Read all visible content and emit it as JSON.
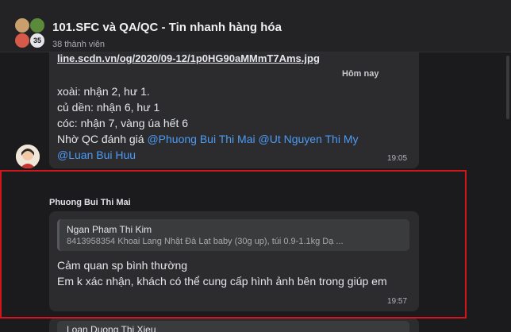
{
  "header": {
    "title": "101.SFC và QA/QC - Tin nhanh hàng hóa",
    "members": "38 thành viên",
    "member_count_badge": "35"
  },
  "message1": {
    "link_text": "line.scdn.vn/og/2020/09-12/1p0HG90aMMmT7Ams.jpg",
    "date_chip": "Hôm nay",
    "lines": [
      "xoài: nhận 2, hư 1.",
      "củ dền: nhận 6, hư 1",
      "cóc: nhận 7, vàng úa hết 6"
    ],
    "request_prefix": "Nhờ QC đánh giá ",
    "mention1": "@Phuong Bui Thi Mai",
    "mention2": "@Ut Nguyen Thi My",
    "mention3": "@Luan Bui Huu",
    "time": "19:05"
  },
  "message2": {
    "sender": "Phuong Bui Thi Mai",
    "quote_author": "Ngan Pham Thi Kim",
    "quote_text": "8413958354 Khoai Lang Nhật Đà Lạt baby (30g up), túi 0.9-1.1kg Dạ ...",
    "line1": "Cảm quan sp bình thường",
    "line2": "Em k xác nhận, khách có thể cung cấp hình ảnh bên trong giúp em",
    "time": "19:57"
  },
  "message3": {
    "quote_author": "Loan Duong Thi Xieu"
  },
  "colors": {
    "mention": "#4c9bf5",
    "highlight": "#d0171b",
    "bubble": "#2c2c2e"
  }
}
